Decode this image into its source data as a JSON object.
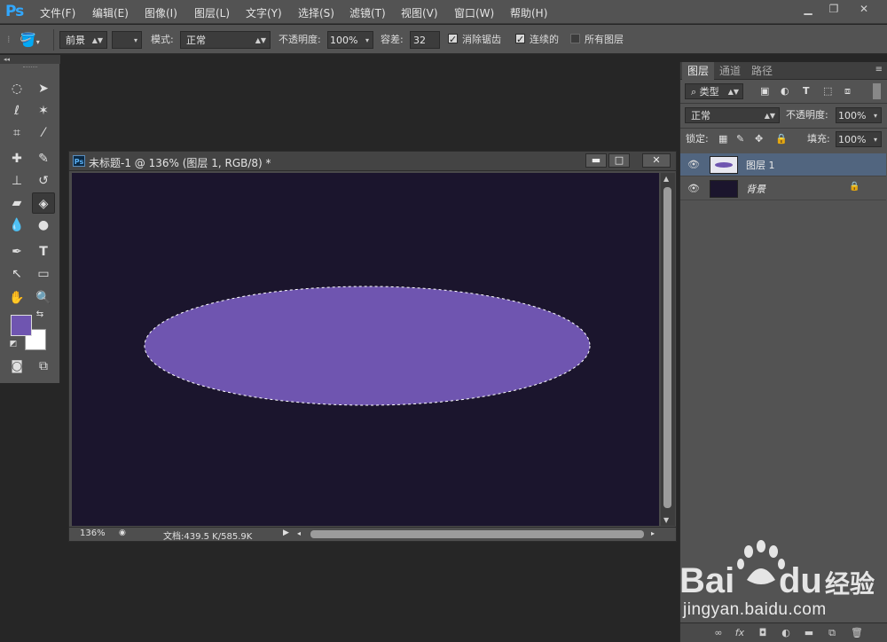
{
  "app": {
    "logo": "Ps",
    "menu": [
      "文件(F)",
      "编辑(E)",
      "图像(I)",
      "图层(L)",
      "文字(Y)",
      "选择(S)",
      "滤镜(T)",
      "视图(V)",
      "窗口(W)",
      "帮助(H)"
    ]
  },
  "options": {
    "fill_source": "前景",
    "mode_label": "模式:",
    "mode_value": "正常",
    "opacity_label": "不透明度:",
    "opacity_value": "100%",
    "tolerance_label": "容差:",
    "tolerance_value": "32",
    "antialias_label": "消除锯齿",
    "contiguous_label": "连续的",
    "all_layers_label": "所有图层",
    "antialias_checked": true,
    "contiguous_checked": true,
    "all_layers_checked": false
  },
  "toolbox": {
    "active_tool": "paint-bucket-icon",
    "foreground_color": "#6f55b0",
    "background_color": "#ffffff"
  },
  "document": {
    "title": "未标题-1 @ 136% (图层 1, RGB/8) *",
    "zoom": "136%",
    "doc_size": "文档:439.5 K/585.9K",
    "canvas_color": "#1b152d",
    "ellipse_color": "#6f55b0"
  },
  "layers_panel": {
    "tabs": [
      "图层",
      "通道",
      "路径"
    ],
    "filter_label": "类型",
    "blend_mode": "正常",
    "opacity_label": "不透明度:",
    "opacity_value": "100%",
    "lock_label": "锁定:",
    "fill_label": "填充:",
    "fill_value": "100%",
    "layers": [
      {
        "name": "图层 1",
        "selected": true,
        "locked": false
      },
      {
        "name": "背景",
        "selected": false,
        "locked": true
      }
    ]
  },
  "watermark": {
    "brand": "Bai",
    "brand2": "du",
    "product": "经验",
    "url": "jingyan.baidu.com"
  }
}
